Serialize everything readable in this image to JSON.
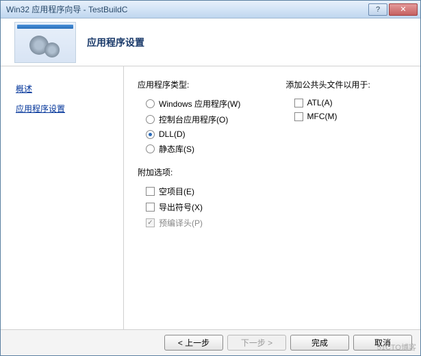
{
  "titlebar": {
    "title": "Win32 应用程序向导 - TestBuildC"
  },
  "header": {
    "title": "应用程序设置"
  },
  "sidebar": {
    "items": [
      {
        "label": "概述"
      },
      {
        "label": "应用程序设置"
      }
    ]
  },
  "content": {
    "appType": {
      "label": "应用程序类型:",
      "options": [
        {
          "label": "Windows 应用程序(W)",
          "selected": false
        },
        {
          "label": "控制台应用程序(O)",
          "selected": false
        },
        {
          "label": "DLL(D)",
          "selected": true
        },
        {
          "label": "静态库(S)",
          "selected": false
        }
      ]
    },
    "additional": {
      "label": "附加选项:",
      "options": [
        {
          "label": "空项目(E)",
          "checked": false,
          "enabled": true
        },
        {
          "label": "导出符号(X)",
          "checked": false,
          "enabled": true
        },
        {
          "label": "预编译头(P)",
          "checked": true,
          "enabled": false
        }
      ]
    },
    "commonHeaders": {
      "label": "添加公共头文件以用于:",
      "options": [
        {
          "label": "ATL(A)",
          "checked": false,
          "enabled": true
        },
        {
          "label": "MFC(M)",
          "checked": false,
          "enabled": true
        }
      ]
    }
  },
  "footer": {
    "prev": "< 上一步",
    "next": "下一步 >",
    "finish": "完成",
    "cancel": "取消"
  },
  "watermark": "51CTO博客"
}
